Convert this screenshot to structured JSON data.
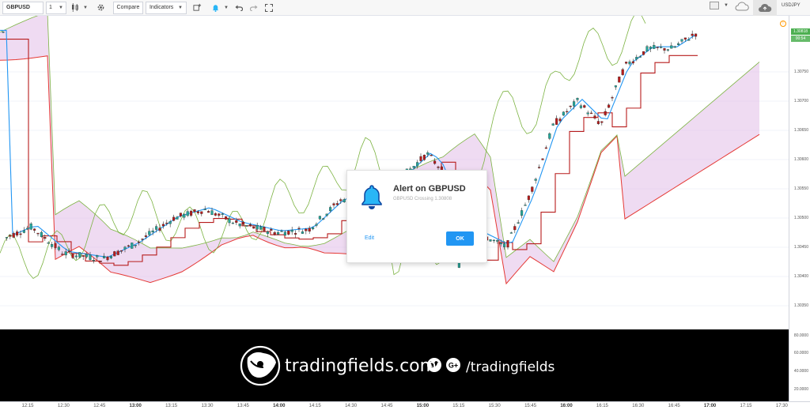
{
  "toolbar": {
    "symbol": "GBPUSD",
    "interval": "1",
    "compare_label": "Compare",
    "indicators_label": "Indicators",
    "symbol_right": "USDJPY"
  },
  "price_axis": {
    "labels": [
      "1.30750",
      "1.30700",
      "1.30650",
      "1.30600",
      "1.30550",
      "1.30500",
      "1.30450",
      "1.30400",
      "1.30350"
    ],
    "current_price": "1.30818",
    "countdown": "00:54"
  },
  "lower_axis": {
    "labels": [
      "80.0000",
      "60.0000",
      "40.0000",
      "20.0000"
    ]
  },
  "time_axis": {
    "labels": [
      {
        "text": "12:15",
        "bold": false
      },
      {
        "text": "12:30",
        "bold": false
      },
      {
        "text": "12:45",
        "bold": false
      },
      {
        "text": "13:00",
        "bold": true
      },
      {
        "text": "13:15",
        "bold": false
      },
      {
        "text": "13:30",
        "bold": false
      },
      {
        "text": "13:45",
        "bold": false
      },
      {
        "text": "14:00",
        "bold": true
      },
      {
        "text": "14:15",
        "bold": false
      },
      {
        "text": "14:30",
        "bold": false
      },
      {
        "text": "14:45",
        "bold": false
      },
      {
        "text": "15:00",
        "bold": true
      },
      {
        "text": "15:15",
        "bold": false
      },
      {
        "text": "15:30",
        "bold": false
      },
      {
        "text": "15:45",
        "bold": false
      },
      {
        "text": "16:00",
        "bold": true
      },
      {
        "text": "16:15",
        "bold": false
      },
      {
        "text": "16:30",
        "bold": false
      },
      {
        "text": "16:45",
        "bold": false
      },
      {
        "text": "17:00",
        "bold": true
      },
      {
        "text": "17:15",
        "bold": false
      },
      {
        "text": "17:30",
        "bold": false
      }
    ]
  },
  "alert": {
    "title": "Alert on GBPUSD",
    "subtitle": "GBPUSD Crossing 1.30808",
    "edit_label": "Edit",
    "ok_label": "OK"
  },
  "banner": {
    "brand": "tradingfields.com",
    "social_handle": "/tradingfields"
  },
  "colors": {
    "candle_up": "#26a69a",
    "candle_down": "#b71c1c",
    "tenkan": "#2196f3",
    "kijun": "#b71c1c",
    "chikou": "#7cb342",
    "cloud_fill": "#e1bee7",
    "accent": "#2196f3"
  },
  "icons": {
    "alert": "bell-icon",
    "settings": "gear-icon",
    "undo": "undo-icon",
    "redo": "redo-icon",
    "fullscreen": "fullscreen-icon",
    "cloud": "cloud-icon"
  }
}
